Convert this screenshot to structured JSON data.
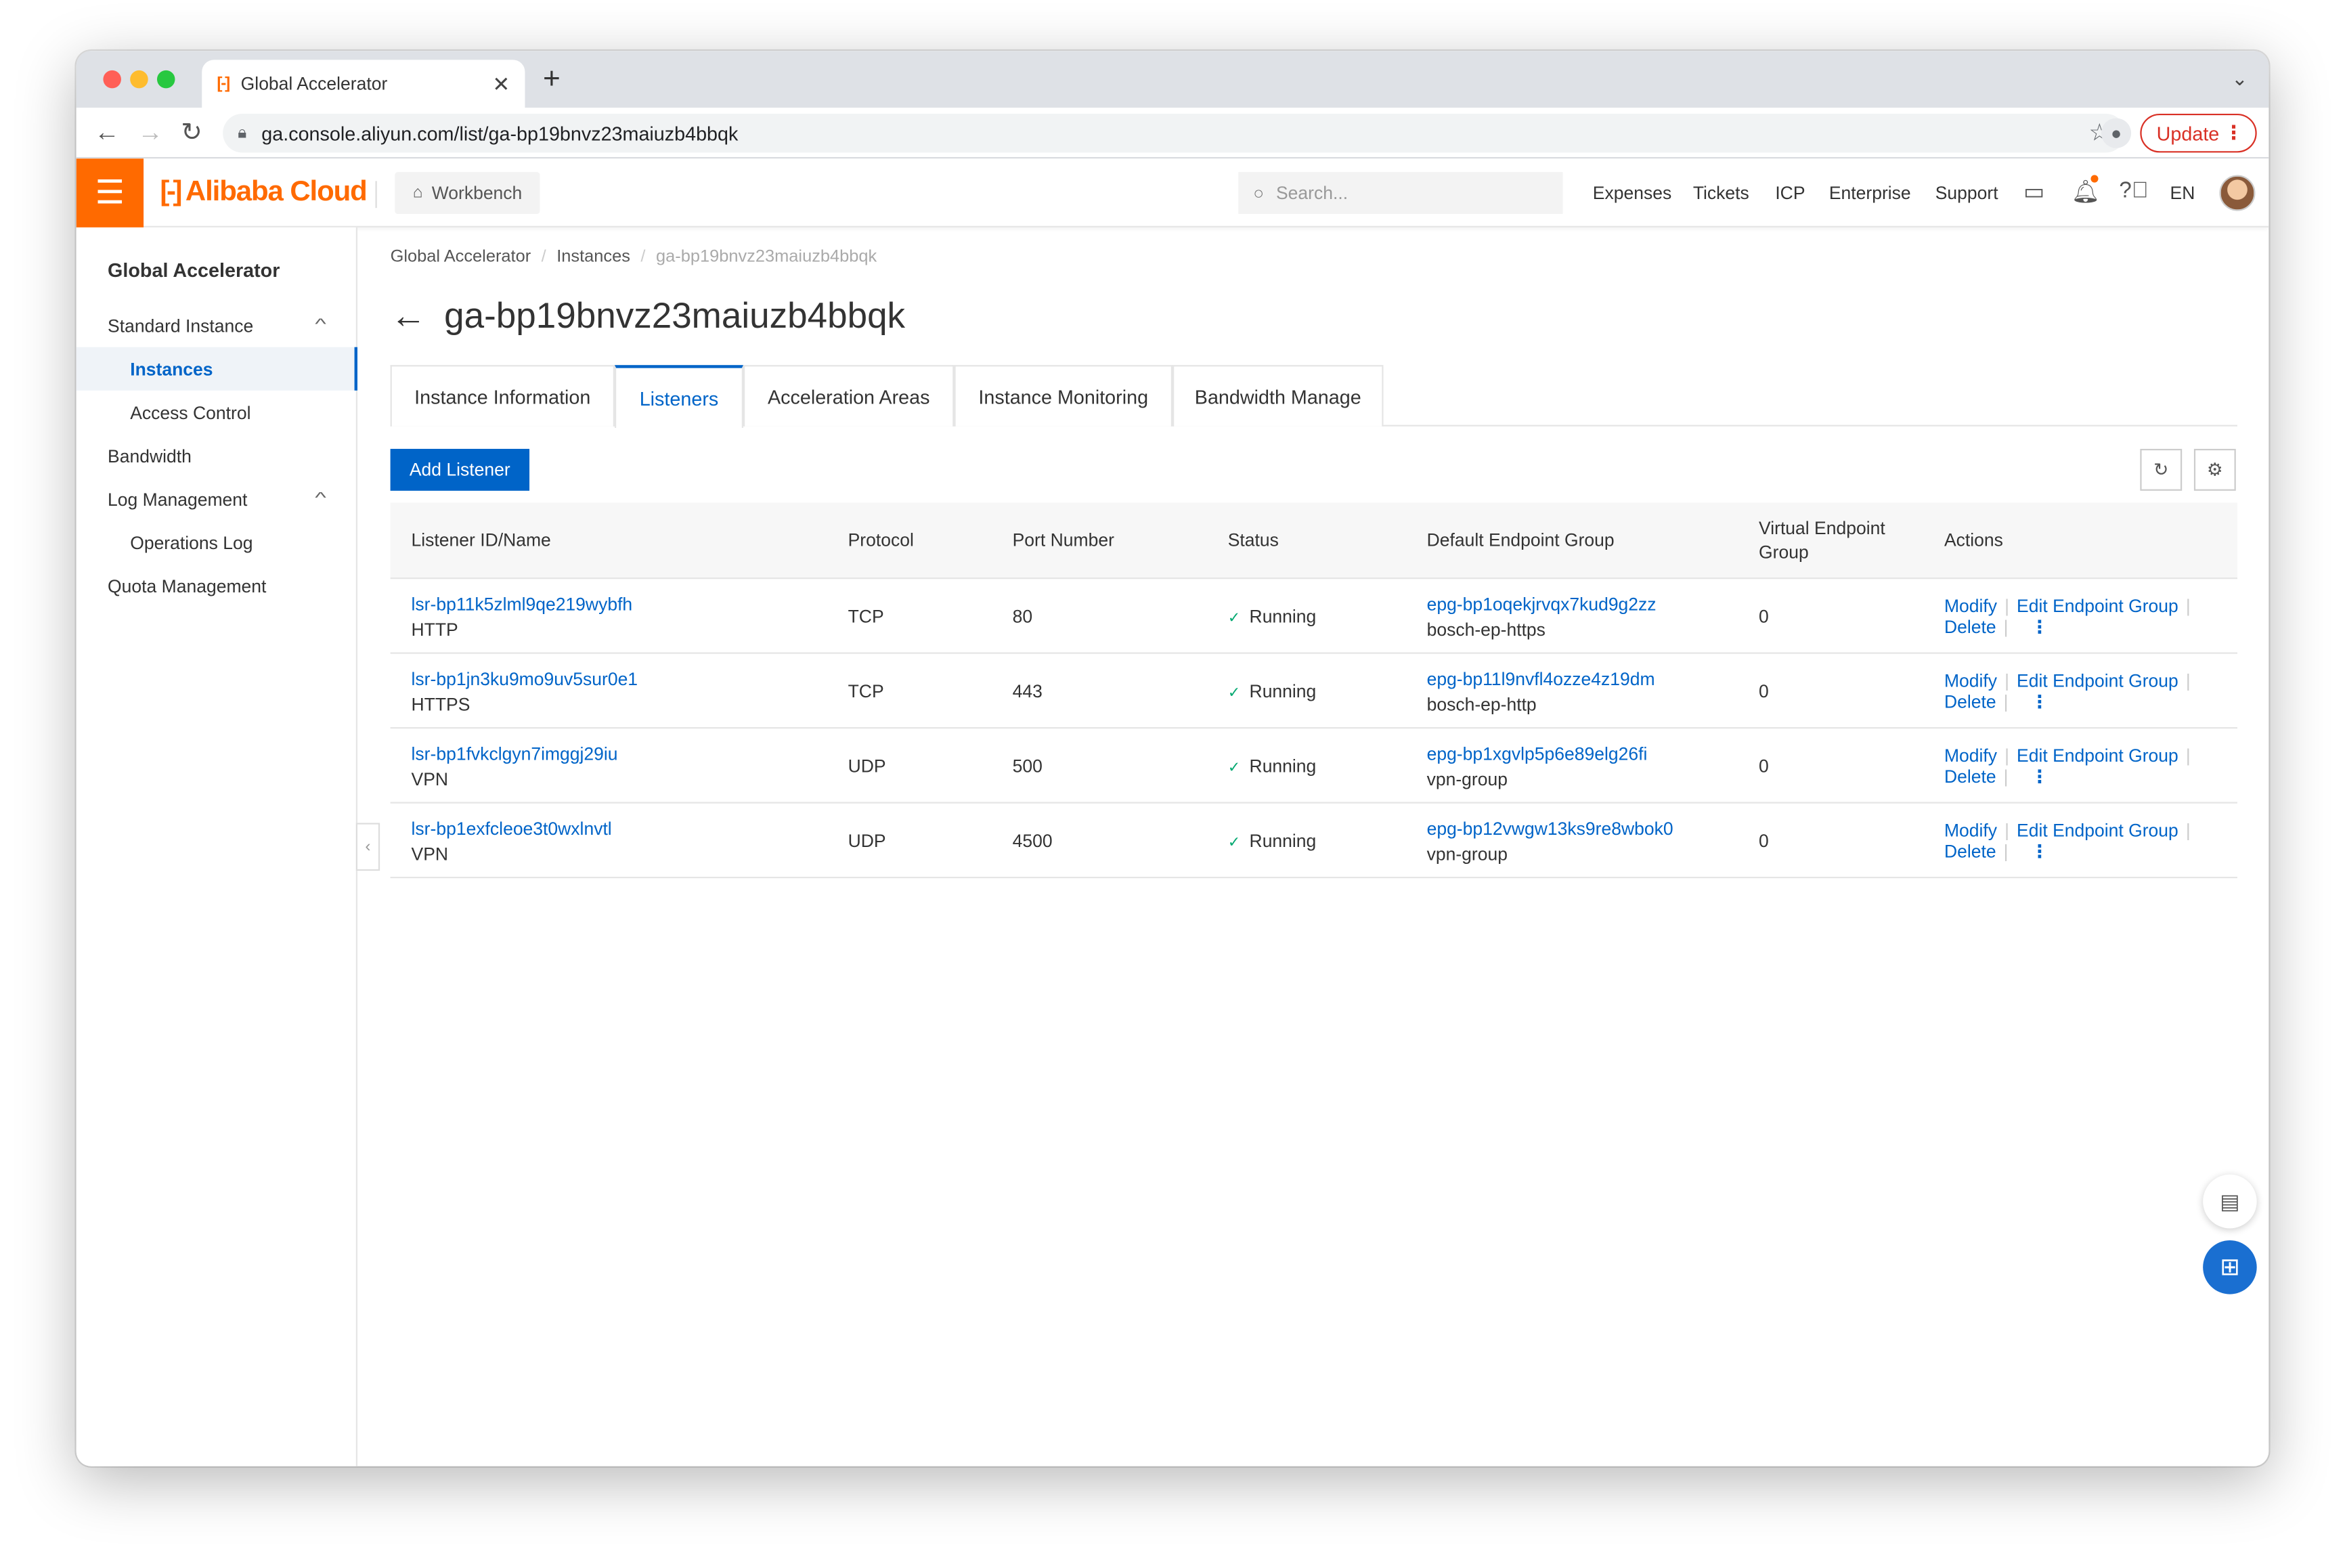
{
  "browser": {
    "tab_title": "Global Accelerator",
    "tab_favicon": "[-]",
    "url": "ga.console.aliyun.com/list/ga-bp19bnvz23maiuzb4bbqk",
    "update_label": "Update"
  },
  "topbar": {
    "logo_text": "Alibaba Cloud",
    "logo_bracket": "[-]",
    "workbench_label": "Workbench",
    "search_placeholder": "Search...",
    "links": {
      "expenses": "Expenses",
      "tickets": "Tickets",
      "icp": "ICP",
      "enterprise": "Enterprise",
      "support": "Support"
    },
    "language": "EN"
  },
  "sidebar": {
    "title": "Global Accelerator",
    "items": [
      {
        "label": "Standard Instance"
      },
      {
        "label": "Instances"
      },
      {
        "label": "Access Control"
      },
      {
        "label": "Bandwidth"
      },
      {
        "label": "Log Management"
      },
      {
        "label": "Operations Log"
      },
      {
        "label": "Quota Management"
      }
    ]
  },
  "breadcrumb": {
    "items": [
      "Global Accelerator",
      "Instances",
      "ga-bp19bnvz23maiuzb4bbqk"
    ]
  },
  "page": {
    "title": "ga-bp19bnvz23maiuzb4bbqk"
  },
  "tabs": [
    {
      "label": "Instance Information"
    },
    {
      "label": "Listeners"
    },
    {
      "label": "Acceleration Areas"
    },
    {
      "label": "Instance Monitoring"
    },
    {
      "label": "Bandwidth Manage"
    }
  ],
  "toolbar": {
    "add_listener_label": "Add Listener"
  },
  "table": {
    "headers": {
      "listener": "Listener ID/Name",
      "protocol": "Protocol",
      "port": "Port Number",
      "status": "Status",
      "default_group": "Default Endpoint Group",
      "virtual_group": "Virtual Endpoint Group",
      "actions": "Actions"
    },
    "actions": {
      "modify": "Modify",
      "edit": "Edit Endpoint Group",
      "delete": "Delete"
    },
    "rows": [
      {
        "id": "lsr-bp11k5zlml9qe219wybfh",
        "name": "HTTP",
        "protocol": "TCP",
        "port": "80",
        "status": "Running",
        "group_id": "epg-bp1oqekjrvqx7kud9g2zz",
        "group_name": "bosch-ep-https",
        "virtual": "0"
      },
      {
        "id": "lsr-bp1jn3ku9mo9uv5sur0e1",
        "name": "HTTPS",
        "protocol": "TCP",
        "port": "443",
        "status": "Running",
        "group_id": "epg-bp11l9nvfl4ozze4z19dm",
        "group_name": "bosch-ep-http",
        "virtual": "0"
      },
      {
        "id": "lsr-bp1fvkclgyn7imggj29iu",
        "name": "VPN",
        "protocol": "UDP",
        "port": "500",
        "status": "Running",
        "group_id": "epg-bp1xgvlp5p6e89elg26fi",
        "group_name": "vpn-group",
        "virtual": "0"
      },
      {
        "id": "lsr-bp1exfcleoe3t0wxlnvtl",
        "name": "VPN",
        "protocol": "UDP",
        "port": "4500",
        "status": "Running",
        "group_id": "epg-bp12vwgw13ks9re8wbok0",
        "group_name": "vpn-group",
        "virtual": "0"
      }
    ]
  },
  "colors": {
    "brand_orange": "#ff6a00",
    "primary_blue": "#0064c8",
    "running_green": "#00a870"
  }
}
